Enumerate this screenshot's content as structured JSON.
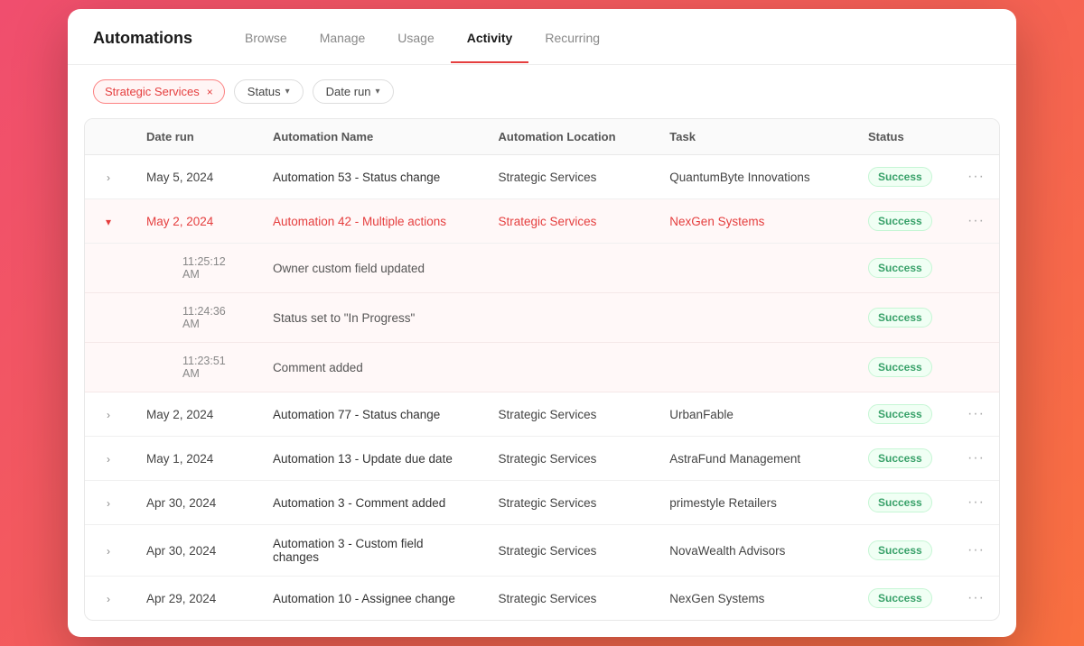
{
  "app": {
    "title": "Automations"
  },
  "tabs": [
    {
      "id": "browse",
      "label": "Browse",
      "active": false
    },
    {
      "id": "manage",
      "label": "Manage",
      "active": false
    },
    {
      "id": "usage",
      "label": "Usage",
      "active": false
    },
    {
      "id": "activity",
      "label": "Activity",
      "active": true
    },
    {
      "id": "recurring",
      "label": "Recurring",
      "active": false
    }
  ],
  "filters": {
    "chip_label": "Strategic Services",
    "status_label": "Status",
    "date_label": "Date run"
  },
  "table": {
    "columns": [
      "Date run",
      "Automation Name",
      "Automation Location",
      "Task",
      "Status"
    ],
    "rows": [
      {
        "id": "r1",
        "expanded": false,
        "date": "May 5, 2024",
        "automation": "Automation 53 - Status change",
        "location": "Strategic Services",
        "task": "QuantumByte Innovations",
        "status": "Success",
        "sub_rows": []
      },
      {
        "id": "r2",
        "expanded": true,
        "date": "May 2, 2024",
        "automation": "Automation 42 - Multiple actions",
        "location": "Strategic Services",
        "task": "NexGen Systems",
        "status": "Success",
        "sub_rows": [
          {
            "time": "11:25:12 AM",
            "action": "Owner custom field updated",
            "status": "Success"
          },
          {
            "time": "11:24:36 AM",
            "action": "Status set to \"In Progress\"",
            "status": "Success"
          },
          {
            "time": "11:23:51 AM",
            "action": "Comment added",
            "status": "Success"
          }
        ]
      },
      {
        "id": "r3",
        "expanded": false,
        "date": "May 2, 2024",
        "automation": "Automation 77 - Status change",
        "location": "Strategic Services",
        "task": "UrbanFable",
        "status": "Success",
        "sub_rows": []
      },
      {
        "id": "r4",
        "expanded": false,
        "date": "May 1, 2024",
        "automation": "Automation 13 - Update due date",
        "location": "Strategic Services",
        "task": "AstraFund Management",
        "status": "Success",
        "sub_rows": []
      },
      {
        "id": "r5",
        "expanded": false,
        "date": "Apr 30, 2024",
        "automation": "Automation 3 - Comment added",
        "location": "Strategic Services",
        "task": "primestyle Retailers",
        "status": "Success",
        "sub_rows": []
      },
      {
        "id": "r6",
        "expanded": false,
        "date": "Apr 30, 2024",
        "automation": "Automation 3 - Custom field changes",
        "location": "Strategic Services",
        "task": "NovaWealth Advisors",
        "status": "Success",
        "sub_rows": []
      },
      {
        "id": "r7",
        "expanded": false,
        "date": "Apr 29, 2024",
        "automation": "Automation 10 - Assignee change",
        "location": "Strategic Services",
        "task": "NexGen Systems",
        "status": "Success",
        "sub_rows": []
      }
    ]
  },
  "icons": {
    "chevron_right": "›",
    "chevron_down": "⌄",
    "close": "×",
    "more": "···"
  }
}
